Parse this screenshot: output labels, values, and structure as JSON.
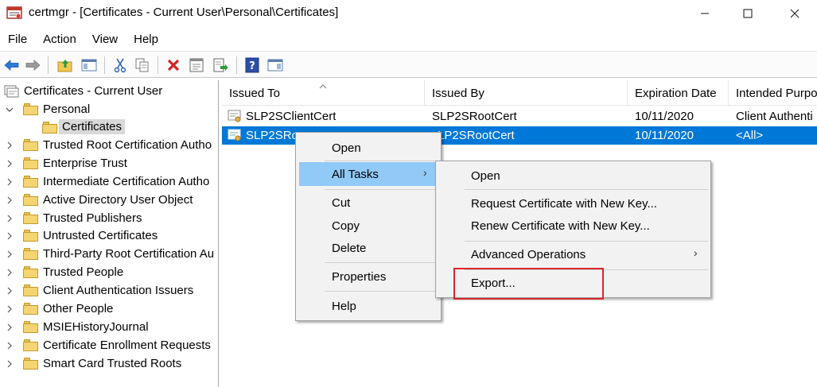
{
  "window": {
    "title": "certmgr - [Certificates - Current User\\Personal\\Certificates]",
    "min_glyph": "—",
    "max_glyph": "☐",
    "close_glyph": "✕"
  },
  "menubar": [
    "File",
    "Action",
    "View",
    "Help"
  ],
  "toolbar_icons": [
    "back-arrow-icon",
    "forward-arrow-icon",
    "up-folder-icon",
    "show-hide-tree-icon",
    "cut-icon",
    "copy-icon",
    "delete-icon",
    "properties-icon",
    "export-list-icon",
    "help-icon",
    "action-pane-icon"
  ],
  "tree": {
    "root": "Certificates - Current User",
    "items": [
      {
        "label": "Personal",
        "expanded": true
      },
      {
        "label": "Certificates",
        "selected": true
      },
      {
        "label": "Trusted Root Certification Autho"
      },
      {
        "label": "Enterprise Trust"
      },
      {
        "label": "Intermediate Certification Autho"
      },
      {
        "label": "Active Directory User Object"
      },
      {
        "label": "Trusted Publishers"
      },
      {
        "label": "Untrusted Certificates"
      },
      {
        "label": "Third-Party Root Certification Au"
      },
      {
        "label": "Trusted People"
      },
      {
        "label": "Client Authentication Issuers"
      },
      {
        "label": "Other People"
      },
      {
        "label": "MSIEHistoryJournal"
      },
      {
        "label": "Certificate Enrollment Requests"
      },
      {
        "label": "Smart Card Trusted Roots"
      }
    ]
  },
  "list": {
    "columns": [
      "Issued To",
      "Issued By",
      "Expiration Date",
      "Intended Purpo"
    ],
    "sort_caret": "^",
    "rows": [
      {
        "issued_to": "SLP2SClientCert",
        "issued_by": "SLP2SRootCert",
        "expiration": "10/11/2020",
        "purpose": "Client Authenti"
      },
      {
        "issued_to": "SLP2SRoo",
        "issued_by": "LP2SRootCert",
        "expiration": "10/11/2020",
        "purpose": "<All>",
        "selected": true
      }
    ]
  },
  "context_menu": {
    "items": [
      "Open",
      "All Tasks",
      "Cut",
      "Copy",
      "Delete",
      "Properties",
      "Help"
    ],
    "submenu_arrow": "›"
  },
  "submenu": {
    "items": [
      "Open",
      "Request Certificate with New Key...",
      "Renew Certificate with New Key...",
      "Advanced Operations",
      "Export..."
    ],
    "submenu_arrow": "›"
  },
  "colors": {
    "selection": "#0078d7",
    "menu_hover": "#91c9f7",
    "highlight_box": "#d9262c"
  }
}
